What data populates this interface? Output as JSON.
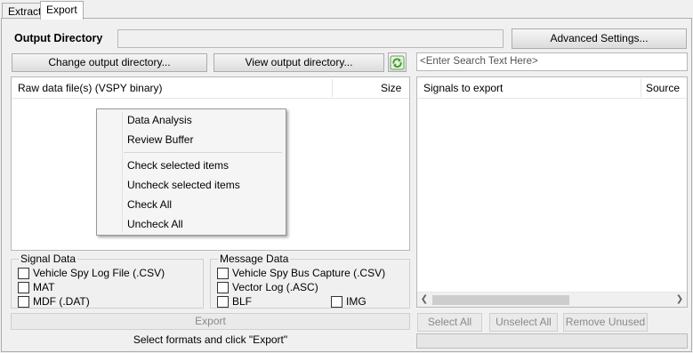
{
  "tabs": [
    {
      "label": "Extract"
    },
    {
      "label": "Export"
    }
  ],
  "output": {
    "directory_label": "Output Directory",
    "directory_value": "",
    "advanced_settings_label": "Advanced Settings...",
    "change_dir_label": "Change output directory...",
    "view_dir_label": "View output directory...",
    "refresh_icon": "refresh-icon"
  },
  "search": {
    "placeholder": "<Enter Search Text Here>"
  },
  "files_table": {
    "columns": [
      "Raw data file(s) (VSPY binary)",
      "Size"
    ],
    "rows": []
  },
  "signals_table": {
    "columns": [
      "Signals to export",
      "Source"
    ],
    "rows": []
  },
  "context_menu": {
    "items": [
      "Data Analysis",
      "Review Buffer",
      "Check selected items",
      "Uncheck selected items",
      "Check All",
      "Uncheck All"
    ]
  },
  "signal_data": {
    "title": "Signal Data",
    "options": [
      {
        "label": "Vehicle Spy Log File (.CSV)",
        "checked": false
      },
      {
        "label": "MAT",
        "checked": false
      },
      {
        "label": "MDF (.DAT)",
        "checked": false
      }
    ]
  },
  "message_data": {
    "title": "Message Data",
    "options": [
      {
        "label": "Vehicle Spy Bus Capture (.CSV)",
        "checked": false
      },
      {
        "label": "Vector Log (.ASC)",
        "checked": false
      },
      {
        "label": "BLF",
        "checked": false
      },
      {
        "label": "IMG",
        "checked": false
      }
    ]
  },
  "export": {
    "button_label": "Export",
    "status_text": "Select formats and click \"Export\""
  },
  "signal_buttons": {
    "select_all": "Select All",
    "unselect_all": "Unselect All",
    "remove_unused": "Remove Unused"
  },
  "colors": {
    "panel_bg": "#f0f0f0",
    "list_bg": "#ffffff",
    "border": "#adadad",
    "disabled_text": "#8a8a8a",
    "refresh_icon_green": "#3f9b2a"
  }
}
